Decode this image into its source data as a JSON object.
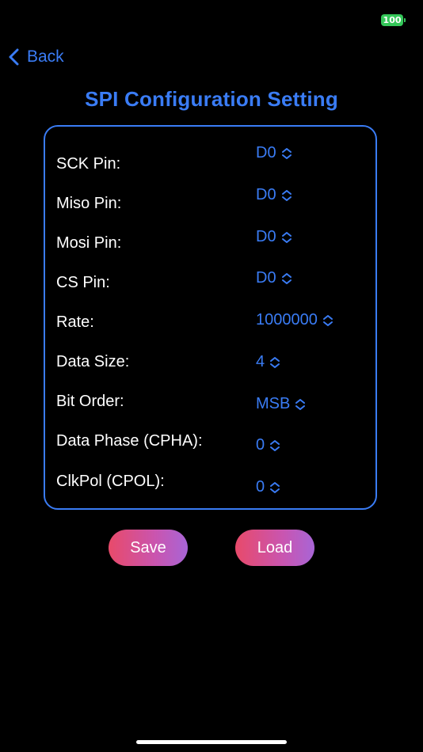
{
  "status_bar": {
    "battery_level": "100",
    "battery_color": "#34c759"
  },
  "nav": {
    "back_label": "Back"
  },
  "page": {
    "title": "SPI Configuration Setting"
  },
  "settings": [
    {
      "label": "SCK Pin:",
      "value": "D0"
    },
    {
      "label": "Miso Pin:",
      "value": "D0"
    },
    {
      "label": "Mosi Pin:",
      "value": "D0"
    },
    {
      "label": "CS Pin:",
      "value": "D0"
    },
    {
      "label": "Rate:",
      "value": "1000000"
    },
    {
      "label": "Data Size:",
      "value": "4"
    },
    {
      "label": "Bit Order:",
      "value": "MSB"
    },
    {
      "label": "Data Phase (CPHA):",
      "value": "0"
    },
    {
      "label": "ClkPol (CPOL):",
      "value": "0"
    }
  ],
  "actions": {
    "save_label": "Save",
    "load_label": "Load"
  },
  "colors": {
    "accent": "#3a7cf5",
    "background": "#000000",
    "button_gradient_start": "#e84a6a",
    "button_gradient_end": "#a865d6"
  }
}
